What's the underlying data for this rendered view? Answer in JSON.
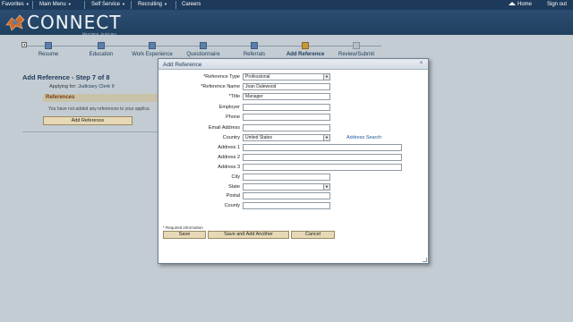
{
  "topnav": {
    "favorites": "Favorites",
    "main_menu": "Main Menu",
    "self_service": "Self Service",
    "recruiting": "Recruiting",
    "careers": "Careers",
    "home": "Home",
    "sign_out": "Sign out"
  },
  "banner": {
    "brand": "CONNECT",
    "subtitle": "Maryland Judiciary"
  },
  "steps": [
    {
      "label": "Resume",
      "state": "done"
    },
    {
      "label": "Education",
      "state": "done"
    },
    {
      "label": "Work Experience",
      "state": "done"
    },
    {
      "label": "Questionnaire",
      "state": "done"
    },
    {
      "label": "Referrals",
      "state": "done"
    },
    {
      "label": "Add Reference",
      "state": "current"
    },
    {
      "label": "Review/Submit",
      "state": "future"
    }
  ],
  "page": {
    "title": "Add Reference - Step 7 of 8",
    "applying_prefix": "Applying for:",
    "applying_job": "Judiciary Clerk II",
    "references_header": "References",
    "references_empty": "You have not added any references to your applica",
    "add_reference_button": "Add Reference"
  },
  "modal": {
    "title": "Add Reference",
    "close": "×",
    "fields": {
      "reference_type": {
        "label": "*Reference Type",
        "value": "Professional"
      },
      "reference_name": {
        "label": "*Reference Name",
        "value": "Joan Dalewood"
      },
      "title": {
        "label": "*Title",
        "value": "Manager"
      },
      "employer": {
        "label": "Employer",
        "value": ""
      },
      "phone": {
        "label": "Phone",
        "value": ""
      },
      "email": {
        "label": "Email Address",
        "value": ""
      },
      "country": {
        "label": "Country",
        "value": "United States"
      },
      "address1": {
        "label": "Address 1",
        "value": ""
      },
      "address2": {
        "label": "Address 2",
        "value": ""
      },
      "address3": {
        "label": "Address 3",
        "value": ""
      },
      "city": {
        "label": "City",
        "value": ""
      },
      "state": {
        "label": "State",
        "value": ""
      },
      "postal": {
        "label": "Postal",
        "value": ""
      },
      "county": {
        "label": "County",
        "value": ""
      }
    },
    "address_search": "Address Search",
    "required_note": "* Required information",
    "save_button": "Save",
    "save_add_button": "Save and Add Another",
    "cancel_button": "Cancel"
  },
  "colors": {
    "navbar": "#1d3a5a",
    "button_bg": "#e7d9b6",
    "current_step": "#c7973d"
  }
}
